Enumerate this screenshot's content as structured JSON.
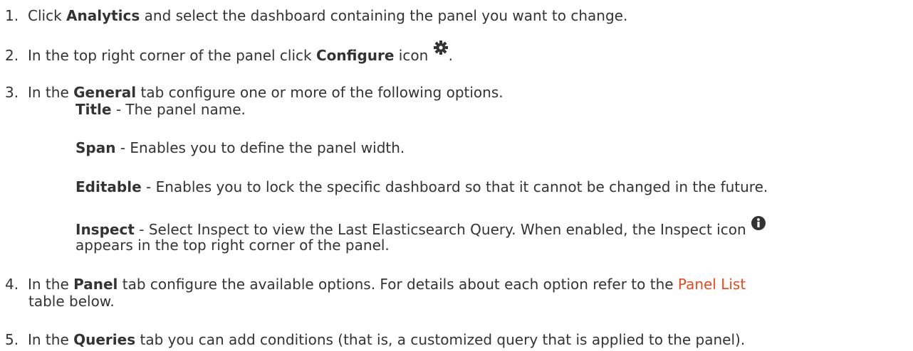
{
  "steps": [
    {
      "number": "1.",
      "pre": "Click ",
      "bold": "Analytics",
      "post": " and select the dashboard containing the panel you want to change."
    },
    {
      "number": "2.",
      "pre": "In the top right corner of the panel click ",
      "bold": "Configure",
      "post": " icon ",
      "icon": "gear-icon",
      "tail": "."
    },
    {
      "number": "3.",
      "pre": "In the ",
      "bold": "General",
      "post": " tab configure one or more of the following options.",
      "options": [
        {
          "bold": "Title",
          "text": " - The panel name."
        },
        {
          "bold": "Span",
          "text": " - Enables you to define the panel width."
        },
        {
          "bold": "Editable",
          "text": " - Enables you to lock the specific dashboard so that it cannot be changed in the future."
        },
        {
          "bold": "Inspect",
          "text": " - Select Inspect to view the Last Elasticsearch Query. When enabled, the Inspect icon ",
          "icon": "info-icon",
          "continuation": " appears in the top right corner of the panel."
        }
      ]
    },
    {
      "number": "4.",
      "pre": "In the ",
      "bold": "Panel",
      "post": " tab configure the available options. For details about each option refer to the ",
      "link": "Panel List",
      "continuation": " table below."
    },
    {
      "number": "5.",
      "pre": "In the ",
      "bold": "Queries",
      "post": " tab you can add conditions (that is, a customized query that is applied to the panel)."
    }
  ],
  "colors": {
    "text": "#333333",
    "link": "#e8491d",
    "icon": "#333333"
  }
}
